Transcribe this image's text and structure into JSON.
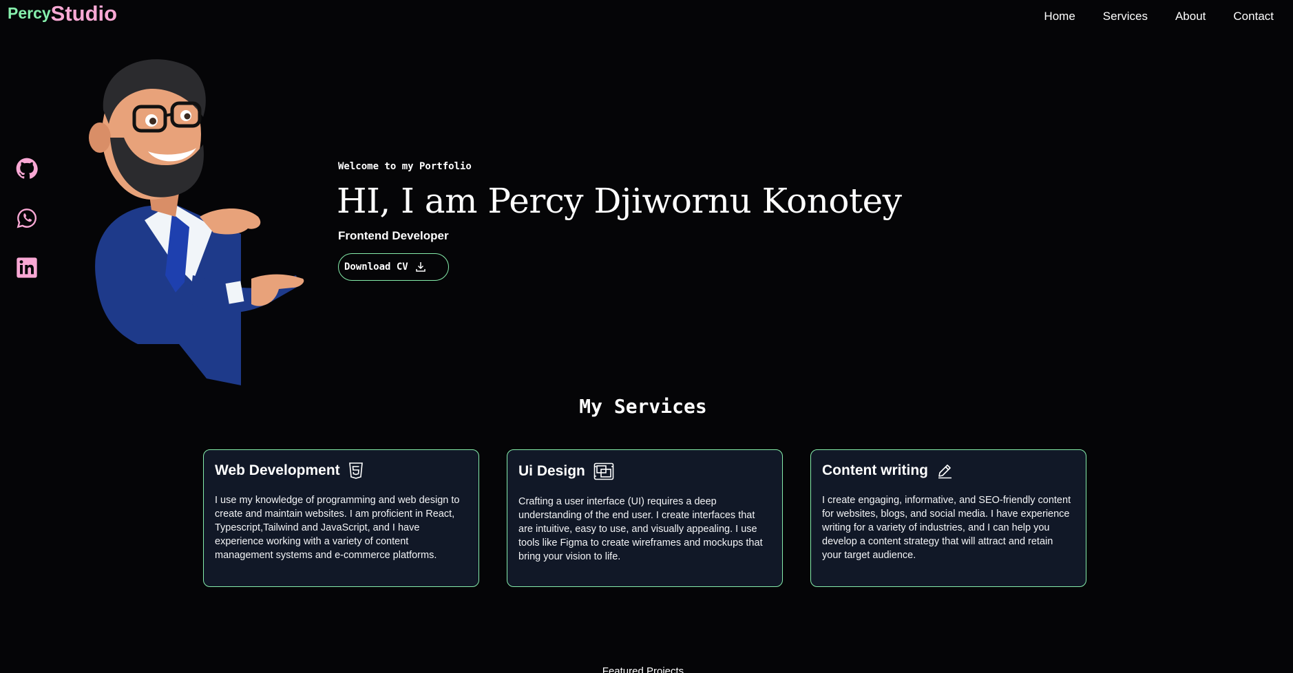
{
  "header": {
    "logo_part1": "Percy",
    "logo_part2": "Studio",
    "nav": [
      "Home",
      "Services",
      "About",
      "Contact"
    ]
  },
  "social": {
    "icons": [
      "github-icon",
      "whatsapp-icon",
      "linkedin-icon"
    ],
    "color": "#f9a8d4"
  },
  "hero": {
    "welcome": "Welcome to my Portfolio",
    "headline": "HI, I am Percy Djiwornu Konotey",
    "role": "Frontend Developer",
    "cv_button": "Download CV",
    "cv_icon": "download-icon"
  },
  "services": {
    "title": "My Services",
    "cards": [
      {
        "title": "Web Development",
        "icon": "html5-icon",
        "text": "I use my knowledge of programming and web design to create and maintain websites. I am proficient in React, Typescript,Tailwind and JavaScript, and I have experience working with a variety of content management systems and e-commerce platforms."
      },
      {
        "title": "Ui Design",
        "icon": "ui-design-icon",
        "text": "Crafting a user interface (UI) requires a deep understanding of the end user. I create interfaces that are intuitive, easy to use, and visually appealing. I use tools like Figma to create wireframes and mockups that bring your vision to life."
      },
      {
        "title": "Content writing",
        "icon": "pencil-icon",
        "text": "I create engaging, informative, and SEO-friendly content for websites, blogs, and social media. I have experience writing for a variety of industries, and I can help you develop a content strategy that will attract and retain your target audience."
      }
    ]
  },
  "featured": {
    "title": "Featured Projects"
  },
  "colors": {
    "background": "#050507",
    "accent_green": "#86efac",
    "accent_pink": "#f9a8d4",
    "card_bg": "#111827"
  }
}
